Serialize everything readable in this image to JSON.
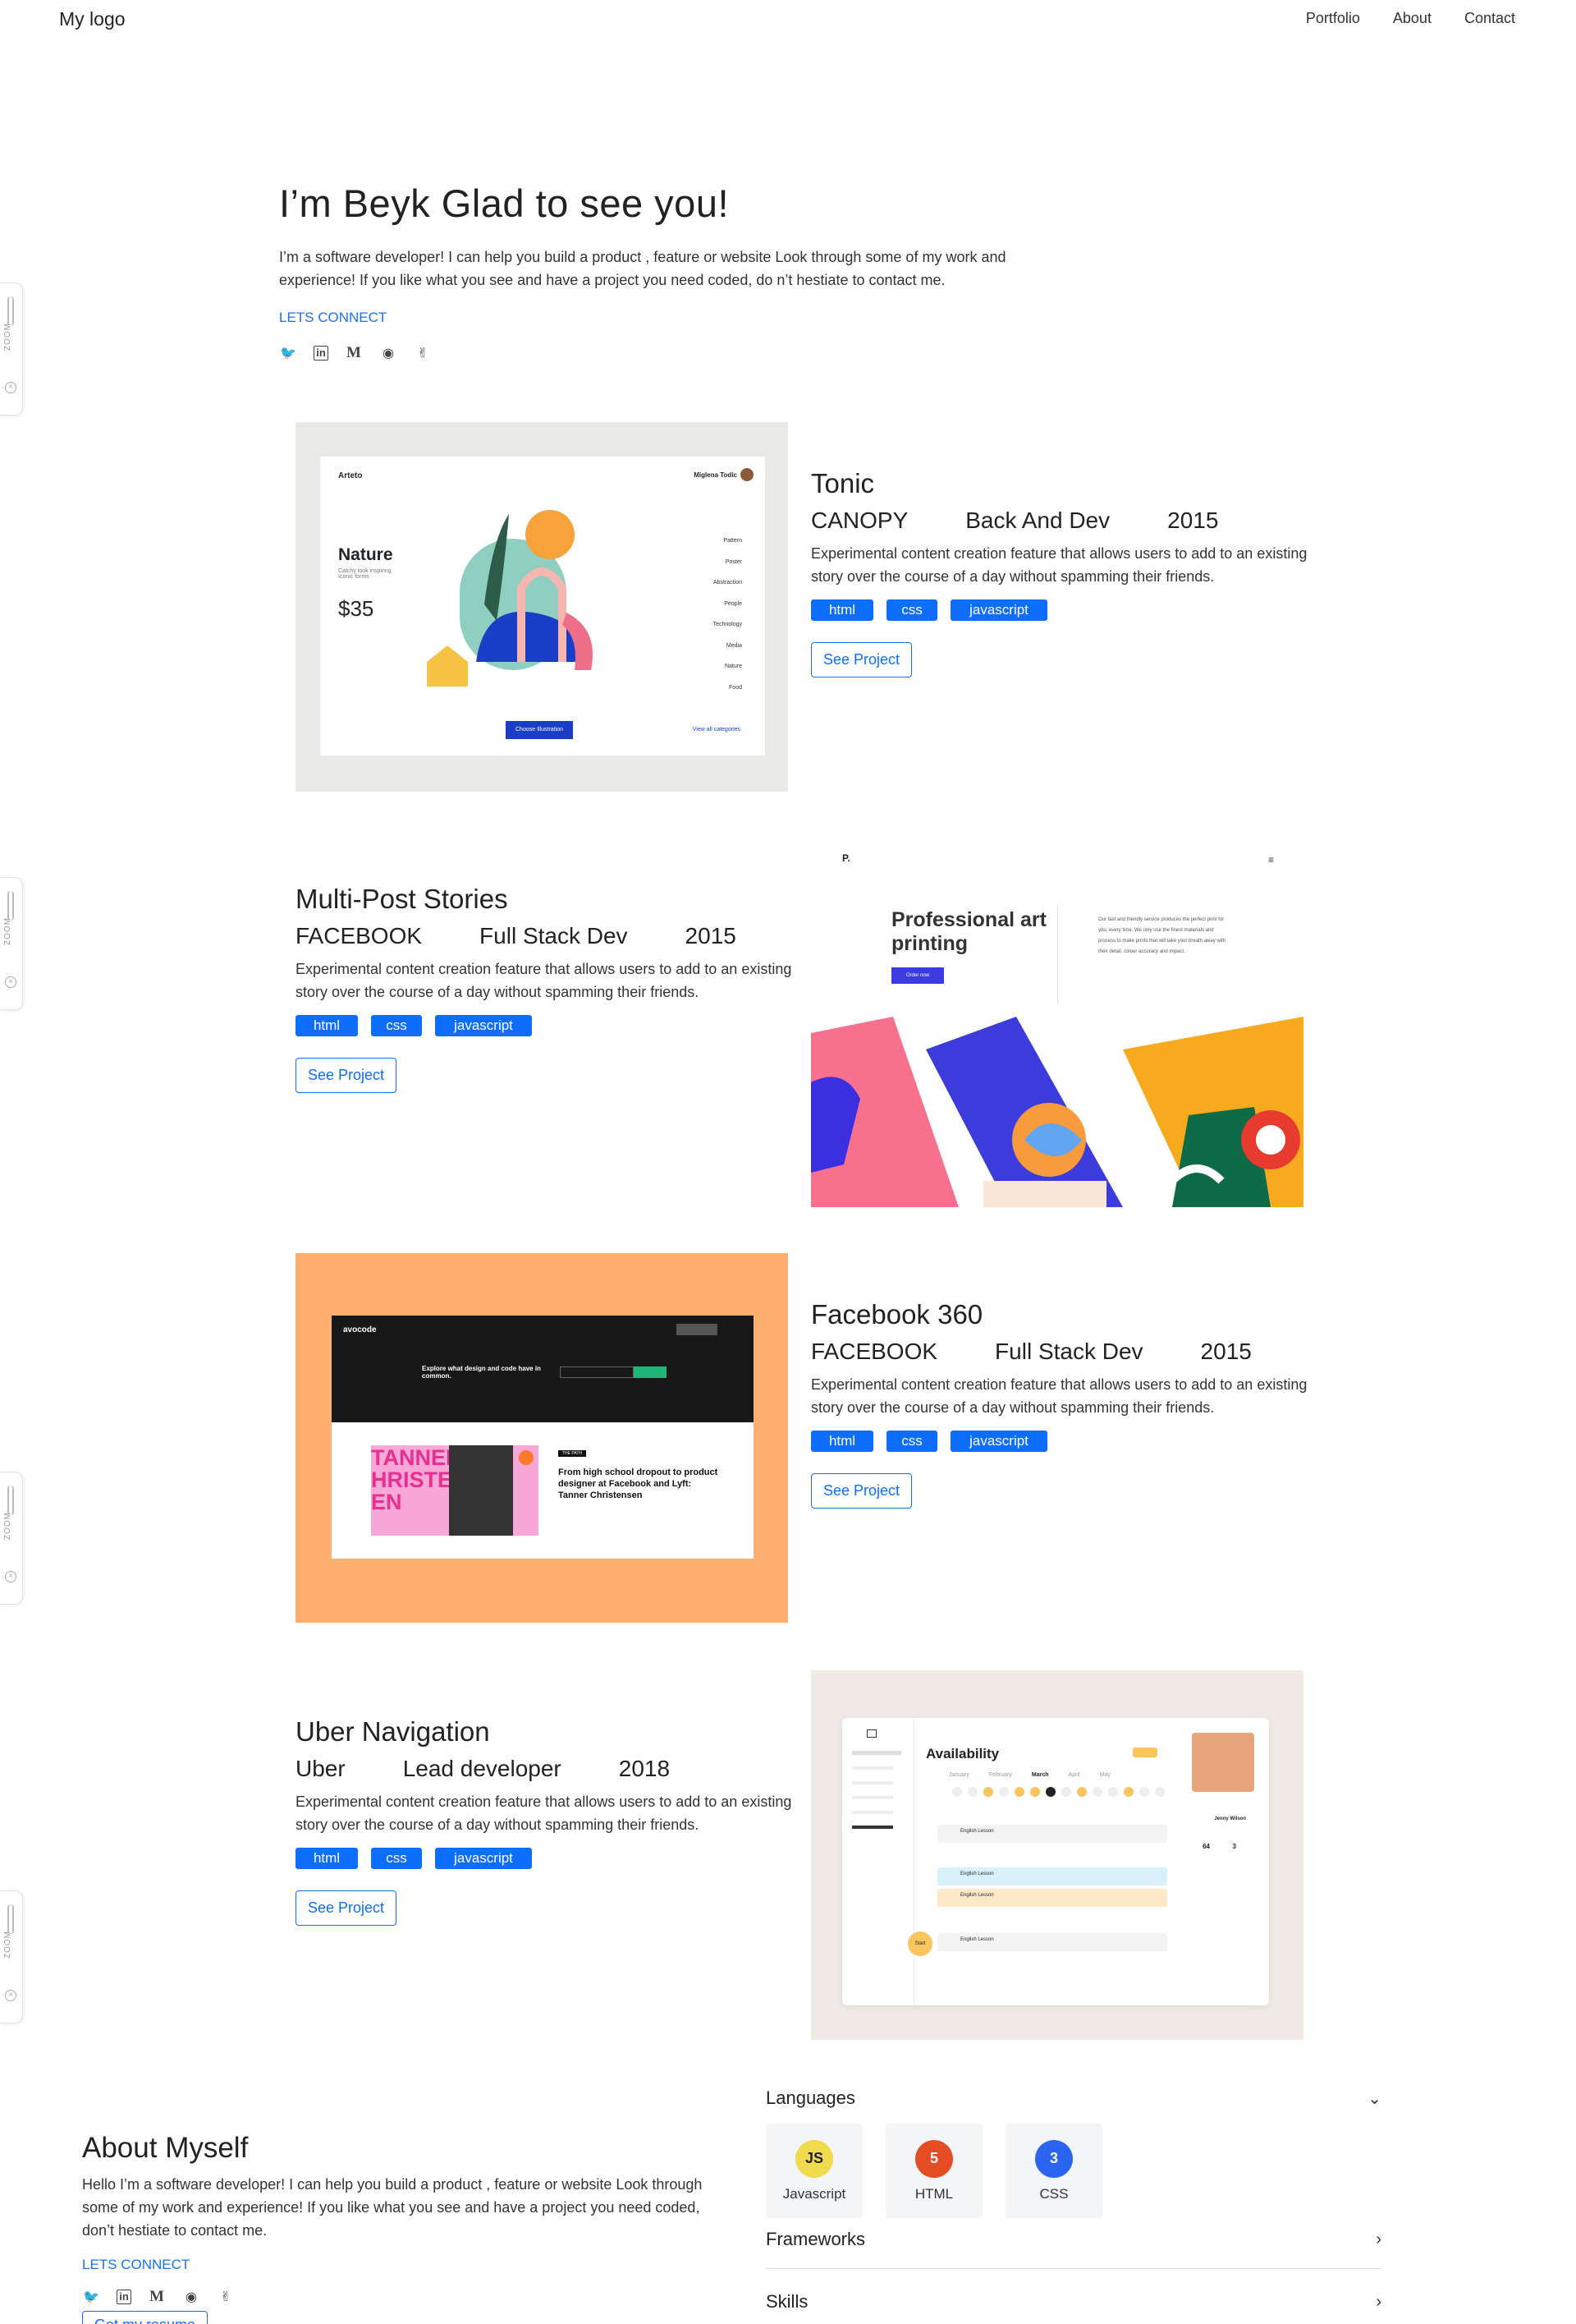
{
  "nav": {
    "logo": "My logo",
    "links": [
      "Portfolio",
      "About",
      "Contact"
    ]
  },
  "zoom_tab": {
    "label": "ZOOM"
  },
  "hero": {
    "title": "I’m Beyk Glad to see you!",
    "text": "I’m a software developer! I can help you build a product , feature or website Look through some of my work and experience! If you like what you see and have a project you need coded, do n’t hestiate to contact me.",
    "connect": "LETS CONNECT"
  },
  "socials": [
    "twitter-icon",
    "linkedin-icon",
    "medium-icon",
    "github-icon",
    "hand-icon"
  ],
  "projects": [
    {
      "title": "Tonic",
      "company": "CANOPY",
      "role": "Back And Dev",
      "year": "2015",
      "description": "Experimental content creation feature that allows users to add to an existing story over the course of a day without spamming their friends.",
      "tags": [
        "html",
        "css",
        "javascript"
      ],
      "button": "See Project",
      "mock": {
        "brand": "Arteto",
        "user": "Miglena Todic",
        "heading": "Nature",
        "sub": "Catchy look inspiring Iconic forms",
        "price": "$35",
        "menu": [
          "Pattern",
          "Poster",
          "Abstraction",
          "People",
          "Technology",
          "Media",
          "Nature",
          "Food"
        ],
        "cta": "Choose Illustration",
        "link": "View all categories"
      }
    },
    {
      "title": "Multi-Post Stories",
      "company": "FACEBOOK",
      "role": "Full Stack Dev",
      "year": "2015",
      "description": "Experimental content creation feature that allows users to add to an existing story over the course of a day without spamming their friends.",
      "tags": [
        "html",
        "css",
        "javascript"
      ],
      "button": "See Project",
      "mock": {
        "brand": "P.",
        "heading": "Professional art printing",
        "cta": "Order now",
        "copy": "Our fast and friendly service produces the perfect print for you, every time. We only use the finest materials and process to make prints that will take your breath away with their detail, colour accuracy and impact."
      }
    },
    {
      "title": "Facebook 360",
      "company": "FACEBOOK",
      "role": "Full Stack Dev",
      "year": "2015",
      "description": "Experimental content creation feature that allows users to add to an existing story over the course of a day without spamming their friends.",
      "tags": [
        "html",
        "css",
        "javascript"
      ],
      "button": "See Project",
      "mock": {
        "brand": "avocode",
        "banner": "Explore what design and code have in common.",
        "article": "From high school dropout to product designer at Facebook and Lyft: Tanner Christensen",
        "poster": "TANNER CHRISTENSEN",
        "badge": "THE PATH"
      }
    },
    {
      "title": "Uber Navigation",
      "company": "Uber",
      "role": "Lead developer",
      "year": "2018",
      "description": "Experimental content creation feature that allows users to add to an existing story over the course of a day without spamming their friends.",
      "tags": [
        "html",
        "css",
        "javascript"
      ],
      "button": "See Project",
      "mock": {
        "heading": "Availability",
        "months": [
          "January",
          "February",
          "March",
          "April",
          "May"
        ],
        "person": "Jenny Wilson",
        "stats": [
          "64",
          "3"
        ],
        "rows": [
          "English Lesson",
          "English Lesson",
          "English Lesson",
          "English Lesson"
        ],
        "fab": "Start"
      }
    }
  ],
  "about": {
    "title": "About Myself",
    "text": "Hello I’m a software developer! I can help you build a product , feature or website Look through some of my work and experience! If you like what you see and have a project you need coded, don’t hestiate to contact me.",
    "connect": "LETS CONNECT",
    "resume": "Get my resume"
  },
  "skills": {
    "languages_title": "Languages",
    "languages": [
      {
        "name": "Javascript",
        "icon": "JS",
        "color": "#f0db4f"
      },
      {
        "name": "HTML",
        "icon": "5",
        "color": "#e44d26"
      },
      {
        "name": "CSS",
        "icon": "3",
        "color": "#2965f1"
      }
    ],
    "frameworks_title": "Frameworks",
    "skills_title": "Skills"
  }
}
